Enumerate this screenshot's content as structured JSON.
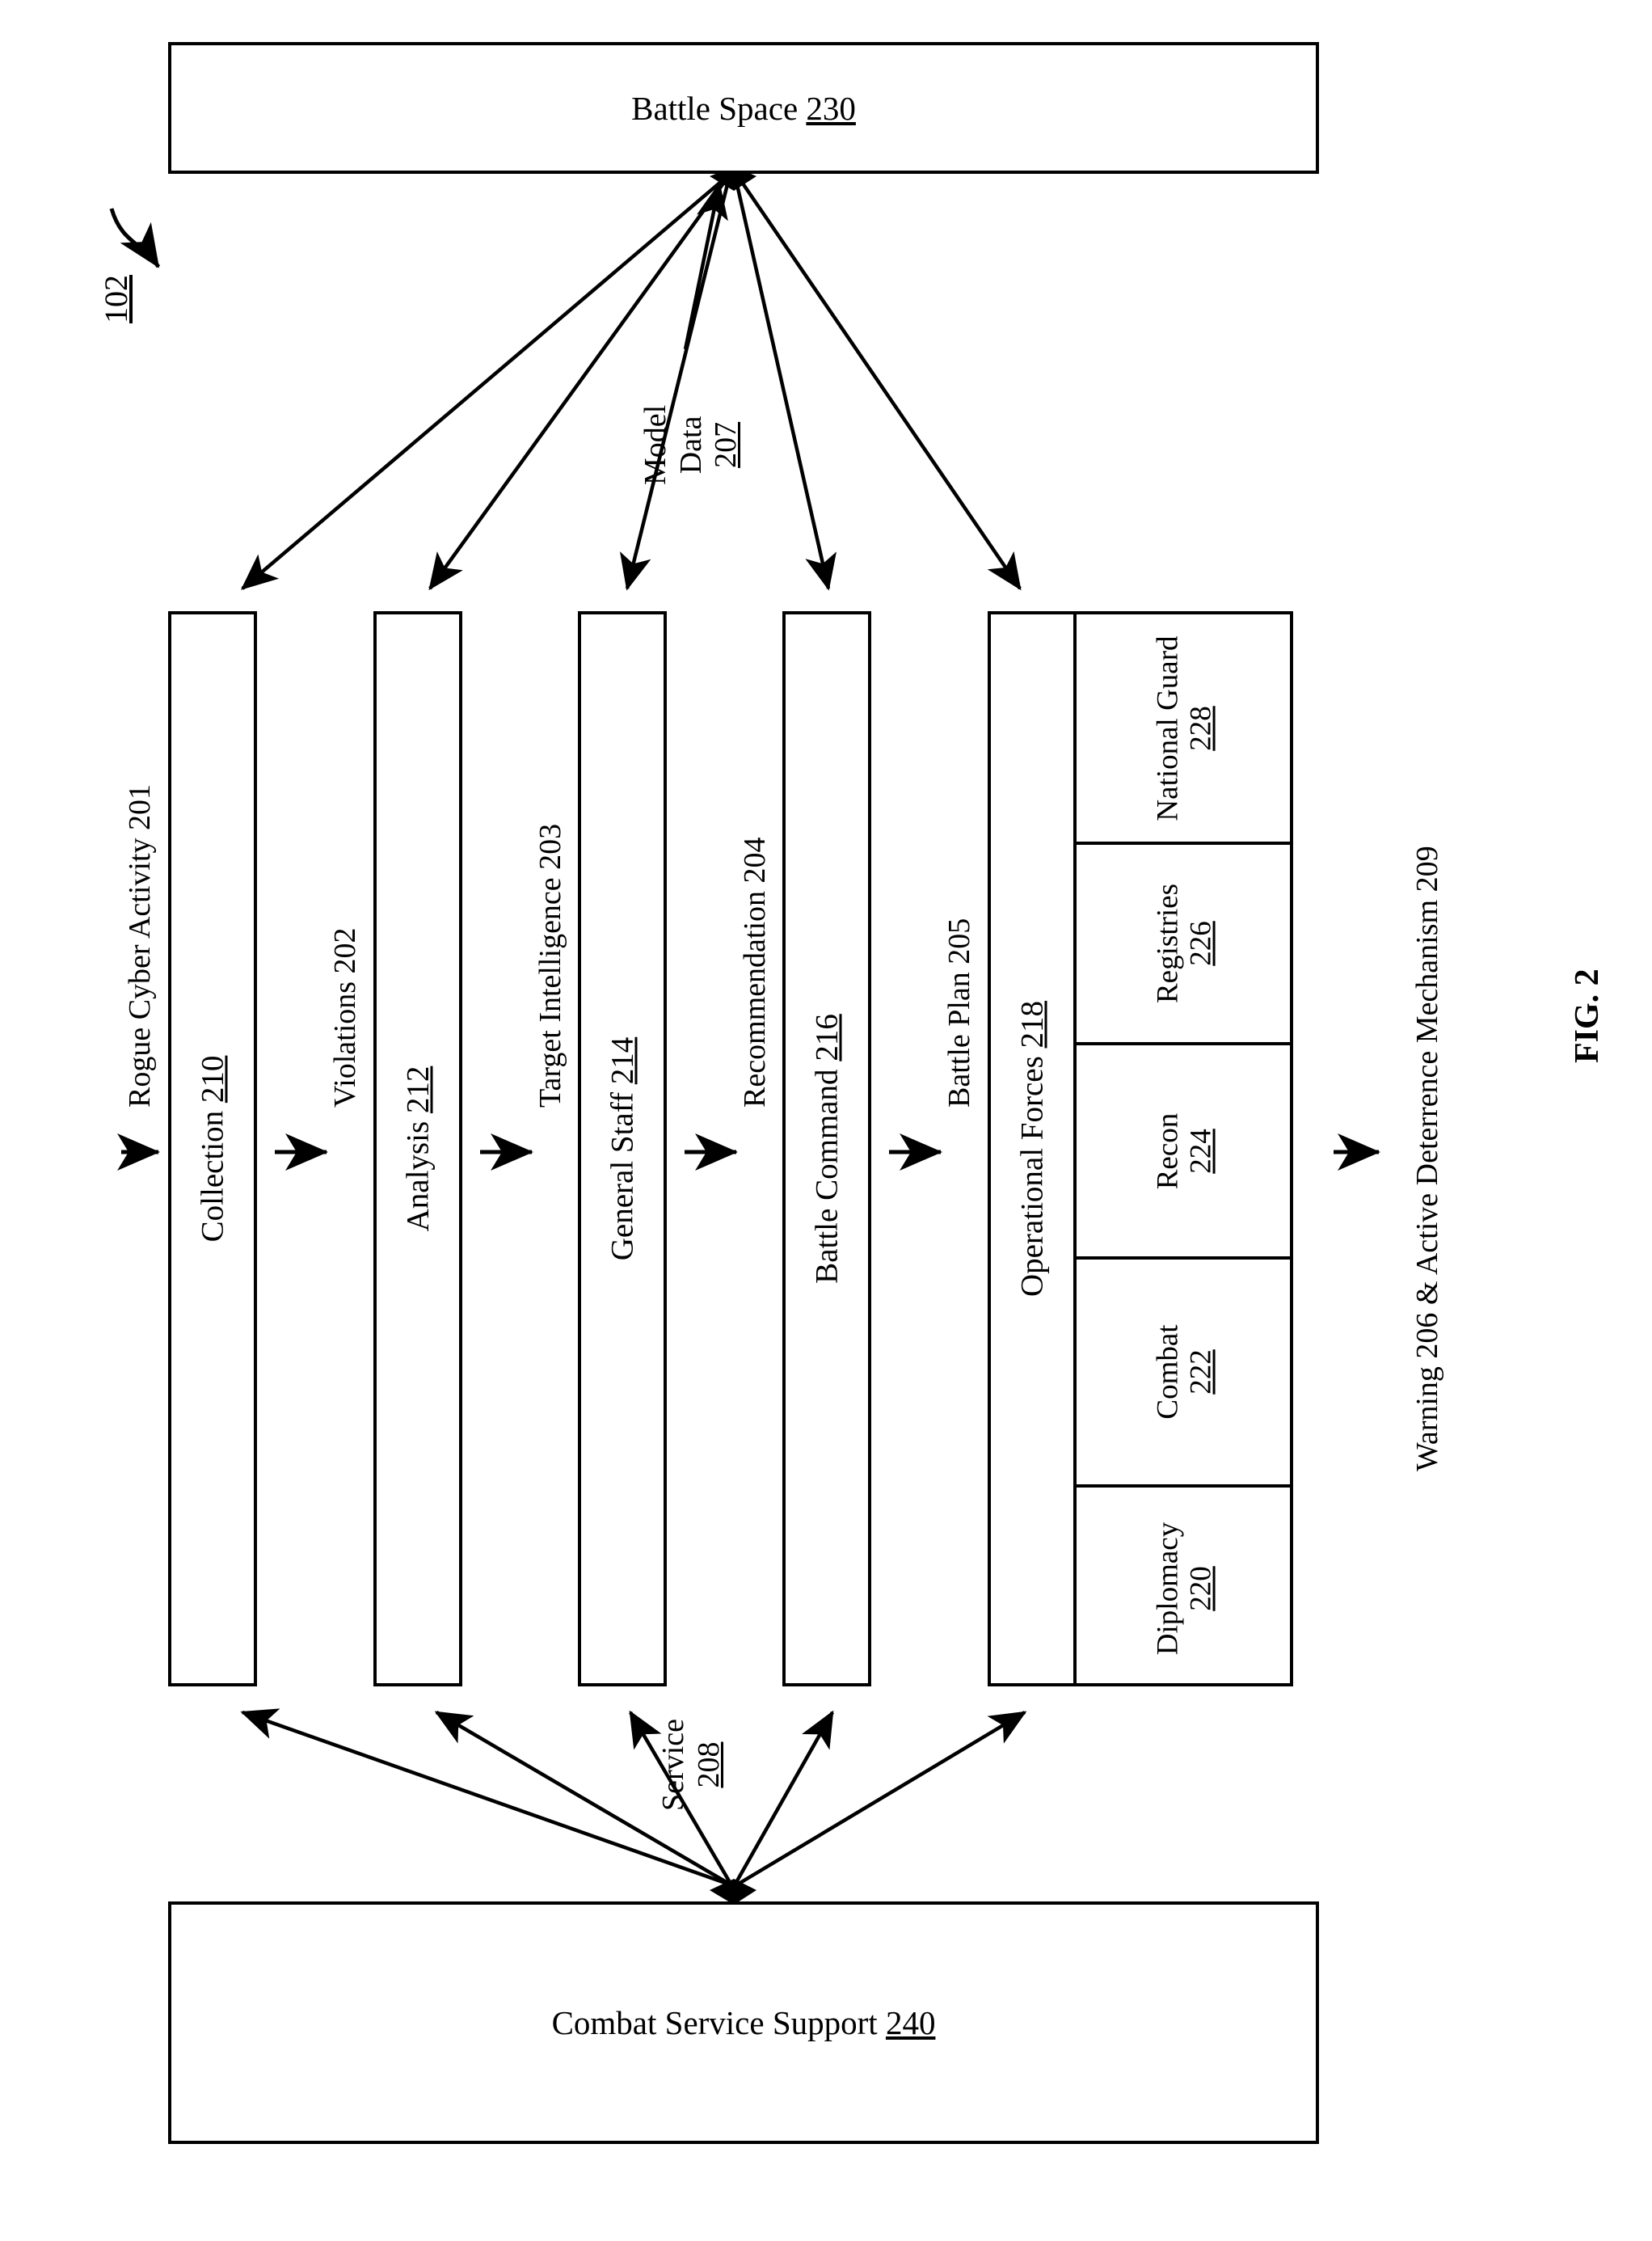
{
  "figure": {
    "caption": "FIG. 2",
    "system_ref": "102"
  },
  "top_box": {
    "label": "Battle Space",
    "ref": "230"
  },
  "bottom_box": {
    "label": "Combat Service Support",
    "ref": "240"
  },
  "columns": [
    {
      "id": "collection",
      "label": "Collection",
      "ref": "210"
    },
    {
      "id": "analysis",
      "label": "Analysis",
      "ref": "212"
    },
    {
      "id": "general-staff",
      "label": "General Staff",
      "ref": "214"
    },
    {
      "id": "battle-command",
      "label": "Battle Command",
      "ref": "216"
    },
    {
      "id": "operational",
      "label": "Operational Forces",
      "ref": "218"
    }
  ],
  "operational_subunits": [
    {
      "id": "diplomacy",
      "label": "Diplomacy",
      "ref": "220"
    },
    {
      "id": "combat",
      "label": "Combat",
      "ref": "222"
    },
    {
      "id": "recon",
      "label": "Recon",
      "ref": "224"
    },
    {
      "id": "registries",
      "label": "Registries",
      "ref": "226"
    },
    {
      "id": "national-guard",
      "label": "National Guard",
      "ref": "228"
    }
  ],
  "flow_labels": [
    {
      "id": "rogue-cyber-activity",
      "text": "Rogue Cyber Activity 201"
    },
    {
      "id": "violations",
      "text": "Violations 202"
    },
    {
      "id": "target-intelligence",
      "text": "Target Intelligence 203"
    },
    {
      "id": "recommendation",
      "text": "Recommendation 204"
    },
    {
      "id": "battle-plan",
      "text": "Battle Plan 205"
    },
    {
      "id": "warning-deterrence",
      "text": "Warning 206 & Active Deterrence Mechanism 209"
    }
  ],
  "data_labels": {
    "model_data": {
      "line1": "Model",
      "line2": "Data",
      "ref": "207"
    },
    "service": {
      "line1": "Service",
      "ref": "208"
    }
  },
  "colors": {
    "stroke": "#000000",
    "fill": "#ffffff"
  }
}
